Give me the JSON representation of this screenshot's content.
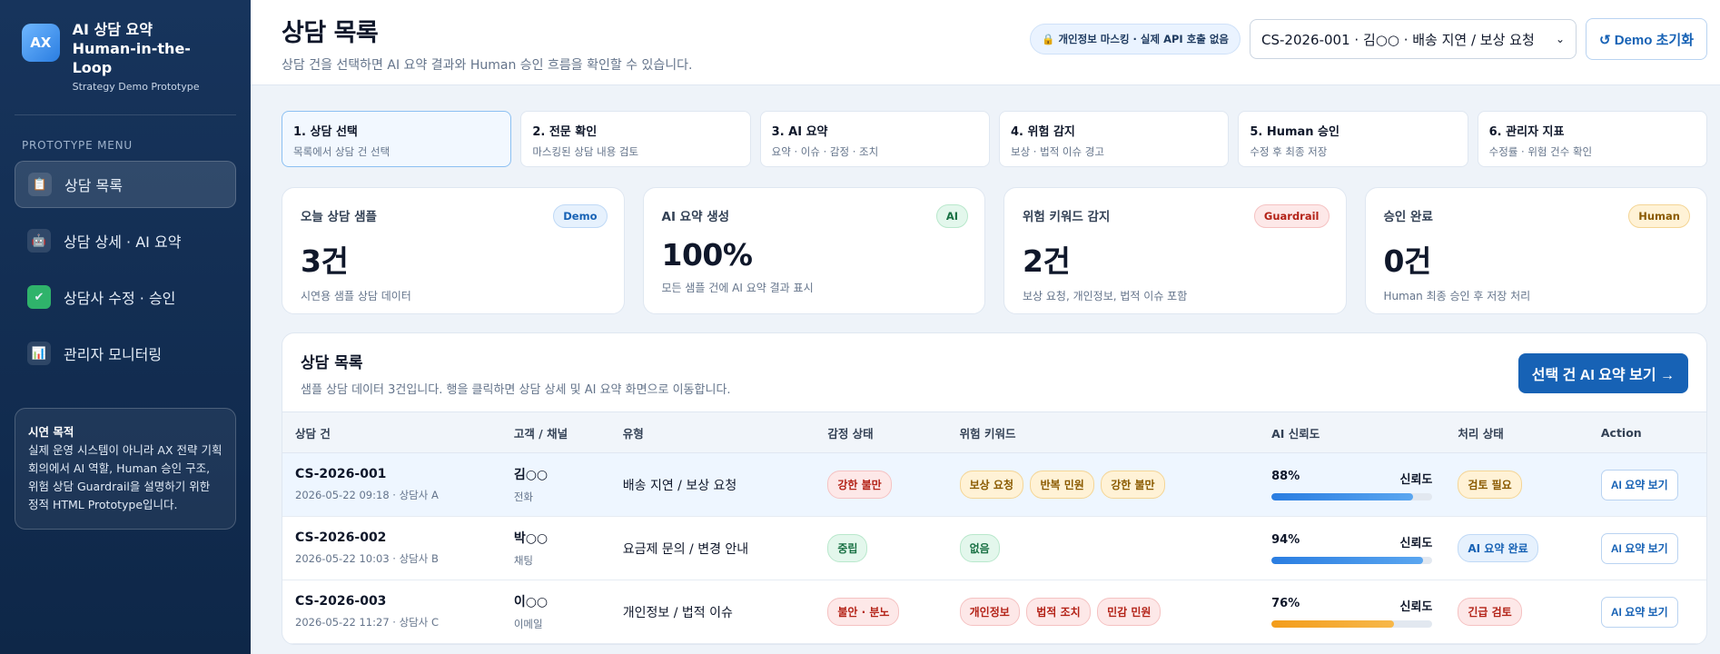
{
  "brand": {
    "logo": "AX",
    "title_line1": "AI 상담 요약",
    "title_line2": "Human-in-the-Loop",
    "subtitle": "Strategy Demo Prototype"
  },
  "sidebar": {
    "heading": "PROTOTYPE MENU",
    "items": [
      {
        "label": "상담 목록",
        "icon": "clipboard-icon"
      },
      {
        "label": "상담 상세 · AI 요약",
        "icon": "robot-icon"
      },
      {
        "label": "상담사 수정 · 승인",
        "icon": "check-icon"
      },
      {
        "label": "관리자 모니터링",
        "icon": "chart-icon"
      }
    ],
    "note_title": "시연 목적",
    "note_body": "실제 운영 시스템이 아니라 AX 전략 기획 회의에서 AI 역할, Human 승인 구조, 위험 상담 Guardrail을 설명하기 위한 정적 HTML Prototype입니다."
  },
  "header": {
    "title": "상담 목록",
    "subtitle": "상담 건을 선택하면 AI 요약 결과와 Human 승인 흐름을 확인할 수 있습니다.",
    "mask_badge": "🔒 개인정보 마스킹 · 실제 API 호출 없음",
    "selected_case": "CS-2026-001 · 김○○ · 배송 지연 / 보상 요청",
    "reset_label": "↺ Demo 초기화"
  },
  "steps": [
    {
      "title": "1. 상담 선택",
      "desc": "목록에서 상담 건 선택"
    },
    {
      "title": "2. 전문 확인",
      "desc": "마스킹된 상담 내용 검토"
    },
    {
      "title": "3. AI 요약",
      "desc": "요약 · 이슈 · 감정 · 조치"
    },
    {
      "title": "4. 위험 감지",
      "desc": "보상 · 법적 이슈 경고"
    },
    {
      "title": "5. Human 승인",
      "desc": "수정 후 최종 저장"
    },
    {
      "title": "6. 관리자 지표",
      "desc": "수정률 · 위험 건수 확인"
    }
  ],
  "stats": [
    {
      "label": "오늘 상담 샘플",
      "value": "3건",
      "desc": "시연용 샘플 상담 데이터",
      "badge": "Demo"
    },
    {
      "label": "AI 요약 생성",
      "value": "100%",
      "desc": "모든 샘플 건에 AI 요약 결과 표시",
      "badge": "AI"
    },
    {
      "label": "위험 키워드 감지",
      "value": "2건",
      "desc": "보상 요청, 개인정보, 법적 이슈 포함",
      "badge": "Guardrail"
    },
    {
      "label": "승인 완료",
      "value": "0건",
      "desc": "Human 최종 승인 후 저장 처리",
      "badge": "Human"
    }
  ],
  "table": {
    "title": "상담 목록",
    "subtitle": "샘플 상담 데이터 3건입니다. 행을 클릭하면 상담 상세 및 AI 요약 화면으로 이동합니다.",
    "cta": "선택 건 AI 요약 보기 →",
    "columns": [
      "상담 건",
      "고객 / 채널",
      "유형",
      "감정 상태",
      "위험 키워드",
      "AI 신뢰도",
      "처리 상태",
      "Action"
    ],
    "rows": [
      {
        "id": "CS-2026-001",
        "meta": "2026-05-22 09:18 · 상담사 A",
        "customer": "김○○",
        "channel": "전화",
        "type": "배송 지연 / 보상 요청",
        "emotion": "강한 불만",
        "keywords": [
          "보상 요청",
          "반복 민원",
          "강한 불만"
        ],
        "confidence": "88%",
        "confidence_label": "신뢰도",
        "confidence_value": 0.88,
        "status": "검토 필요",
        "action": "AI 요약 보기"
      },
      {
        "id": "CS-2026-002",
        "meta": "2026-05-22 10:03 · 상담사 B",
        "customer": "박○○",
        "channel": "채팅",
        "type": "요금제 문의 / 변경 안내",
        "emotion": "중립",
        "keywords": [
          "없음"
        ],
        "confidence": "94%",
        "confidence_label": "신뢰도",
        "confidence_value": 0.94,
        "status": "AI 요약 완료",
        "action": "AI 요약 보기"
      },
      {
        "id": "CS-2026-003",
        "meta": "2026-05-22 11:27 · 상담사 C",
        "customer": "이○○",
        "channel": "이메일",
        "type": "개인정보 / 법적 이슈",
        "emotion": "불안 · 분노",
        "keywords": [
          "개인정보",
          "법적 조치",
          "민감 민원"
        ],
        "confidence": "76%",
        "confidence_label": "신뢰도",
        "confidence_value": 0.76,
        "status": "긴급 검토",
        "action": "AI 요약 보기"
      }
    ]
  },
  "colors": {
    "primary": "#1762b5",
    "sidebar": "#17345c",
    "bar_blue": "#3b8ee6",
    "bar_orange": "#f39c1a"
  }
}
